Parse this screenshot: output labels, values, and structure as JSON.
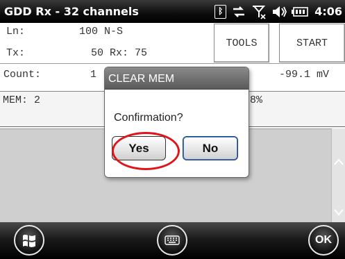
{
  "titlebar": {
    "title": "GDD Rx - 32 channels",
    "time": "4:06",
    "icons": [
      "bluetooth-icon",
      "connectivity-icon",
      "signal-off-icon",
      "volume-icon",
      "battery-icon"
    ]
  },
  "app": {
    "ln_label": "Ln:",
    "ln_value": "100 N-S",
    "tx_label": "Tx:",
    "tx_rx_value": "50 Rx: 75",
    "count_label": "Count:",
    "count_value": "1",
    "voltage": "-99.1 mV",
    "tools_button": "TOOLS",
    "start_button": "START",
    "mem_label": "MEM: 2",
    "percent_partial": "8%"
  },
  "dialog": {
    "title": "CLEAR MEM",
    "message": "Confirmation?",
    "yes_label": "Yes",
    "no_label": "No"
  },
  "bottombar": {
    "ok_label": "OK",
    "icons": [
      "windows-start-icon",
      "keyboard-icon"
    ]
  },
  "colors": {
    "highlight": "#e0151b",
    "dialog_title_bg": "#6e6e6e",
    "listbox_bg": "#cfcfcf"
  }
}
